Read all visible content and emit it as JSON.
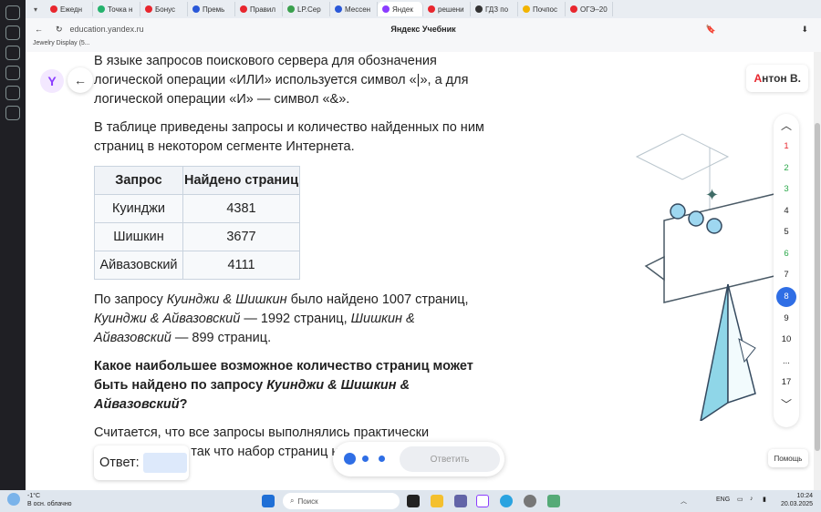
{
  "browser": {
    "tabs": [
      {
        "label": "Ежедн",
        "color": "#e8262e"
      },
      {
        "label": "Точка н",
        "color": "#25b26d"
      },
      {
        "label": "Бонус",
        "color": "#e8262e"
      },
      {
        "label": "Премь",
        "color": "#2a58d8"
      },
      {
        "label": "Правил",
        "color": "#e8262e"
      },
      {
        "label": "LP.Сер",
        "color": "#3aa04d"
      },
      {
        "label": "Мессен",
        "color": "#2a58d8"
      },
      {
        "label": "Яндек",
        "color": "#8b3dff",
        "active": true
      },
      {
        "label": "решени",
        "color": "#e8262e"
      },
      {
        "label": "ГДЗ по",
        "color": "#333333"
      },
      {
        "label": "Почпос",
        "color": "#f2b400"
      },
      {
        "label": "ОГЭ–20",
        "color": "#e8262e"
      }
    ],
    "url": "education.yandex.ru",
    "page_title": "Яндекс Учебник",
    "bookmark": "Jewelry Display (5..."
  },
  "header": {
    "user_first": "А",
    "user_rest": "нтон В."
  },
  "task": {
    "p1": "В языке запросов поискового сервера для обозначения логической операции «ИЛИ» используется символ «|», а для логической операции «И» — символ «&».",
    "p2": "В таблице приведены запросы и количество найденных по ним страниц в некотором сегменте Интернета.",
    "table": {
      "headers": [
        "Запрос",
        "Найдено страниц"
      ],
      "rows": [
        [
          "Куинджи",
          "4381"
        ],
        [
          "Шишкин",
          "3677"
        ],
        [
          "Айвазовский",
          "4111"
        ]
      ]
    },
    "p3a": "По запросу ",
    "p3b": "Куинджи & Шишкин",
    "p3c": " было найдено 1007 страниц, ",
    "p3d": "Куинджи & Айвазовский",
    "p3e": " — 1992 страниц, ",
    "p3f": "Шишкин & Айвазовский",
    "p3g": " — 899 страниц.",
    "q1": "Какое наибольшее возможное количество страниц может быть найдено по запросу ",
    "q2": "Куинджи & Шишкин & Айвазовский",
    "q3": "?",
    "p5": "Считается, что все запросы выполнялись практически одновременно, так что набор страниц не менялся.",
    "answer_label": "Ответ:",
    "send_label": "Ответить"
  },
  "nav": {
    "items": [
      {
        "n": "1",
        "state": "red"
      },
      {
        "n": "2",
        "state": "green"
      },
      {
        "n": "3",
        "state": "green"
      },
      {
        "n": "4",
        "state": ""
      },
      {
        "n": "5",
        "state": ""
      },
      {
        "n": "6",
        "state": "green"
      },
      {
        "n": "7",
        "state": ""
      },
      {
        "n": "8",
        "state": "cur"
      },
      {
        "n": "9",
        "state": ""
      },
      {
        "n": "10",
        "state": ""
      },
      {
        "n": "...",
        "state": ""
      },
      {
        "n": "17",
        "state": ""
      }
    ]
  },
  "help_label": "Помощь",
  "taskbar": {
    "weather_temp": "-1°C",
    "weather_desc": "В осн. облачно",
    "search_placeholder": "Поиск",
    "lang": "ENG",
    "time": "10:24",
    "date": "20.03.2025"
  }
}
